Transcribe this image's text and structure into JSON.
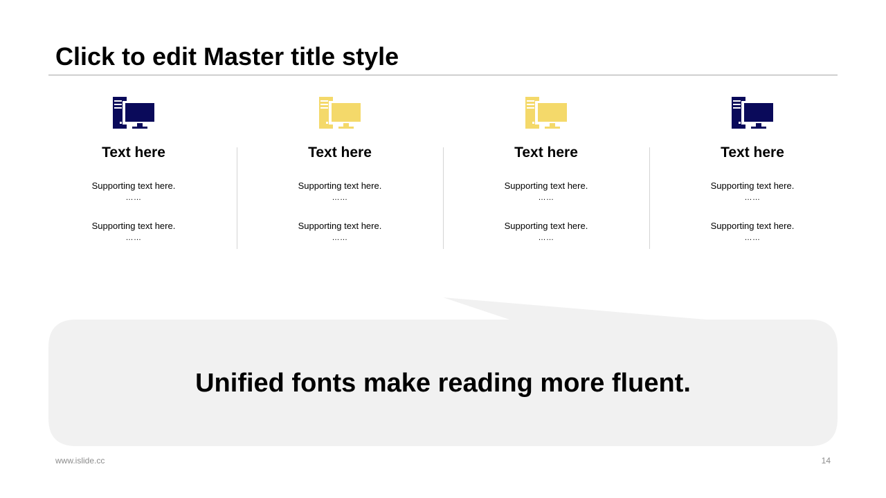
{
  "slide": {
    "title": "Click to edit Master title style",
    "footer_url": "www.islide.cc",
    "page_number": "14"
  },
  "colors": {
    "navy": "#0a0a5a",
    "yellow": "#f4d96a",
    "callout_bg": "#f1f1f1",
    "rule": "#a6a6a6"
  },
  "columns": [
    {
      "icon": "desktop-computer-icon",
      "icon_color": "#0a0a5a",
      "heading": "Text here",
      "support_1": "Supporting  text here.",
      "dots_1": "……",
      "support_2": "Supporting  text here.",
      "dots_2": "……"
    },
    {
      "icon": "desktop-computer-icon",
      "icon_color": "#f4d96a",
      "heading": "Text here",
      "support_1": "Supporting  text here.",
      "dots_1": "……",
      "support_2": "Supporting  text here.",
      "dots_2": "……"
    },
    {
      "icon": "desktop-computer-icon",
      "icon_color": "#f4d96a",
      "heading": "Text here",
      "support_1": "Supporting  text here.",
      "dots_1": "……",
      "support_2": "Supporting  text here.",
      "dots_2": "……"
    },
    {
      "icon": "desktop-computer-icon",
      "icon_color": "#0a0a5a",
      "heading": "Text here",
      "support_1": "Supporting  text here.",
      "dots_1": "……",
      "support_2": "Supporting  text here.",
      "dots_2": "……"
    }
  ],
  "callout": {
    "text": "Unified fonts make reading more fluent."
  }
}
